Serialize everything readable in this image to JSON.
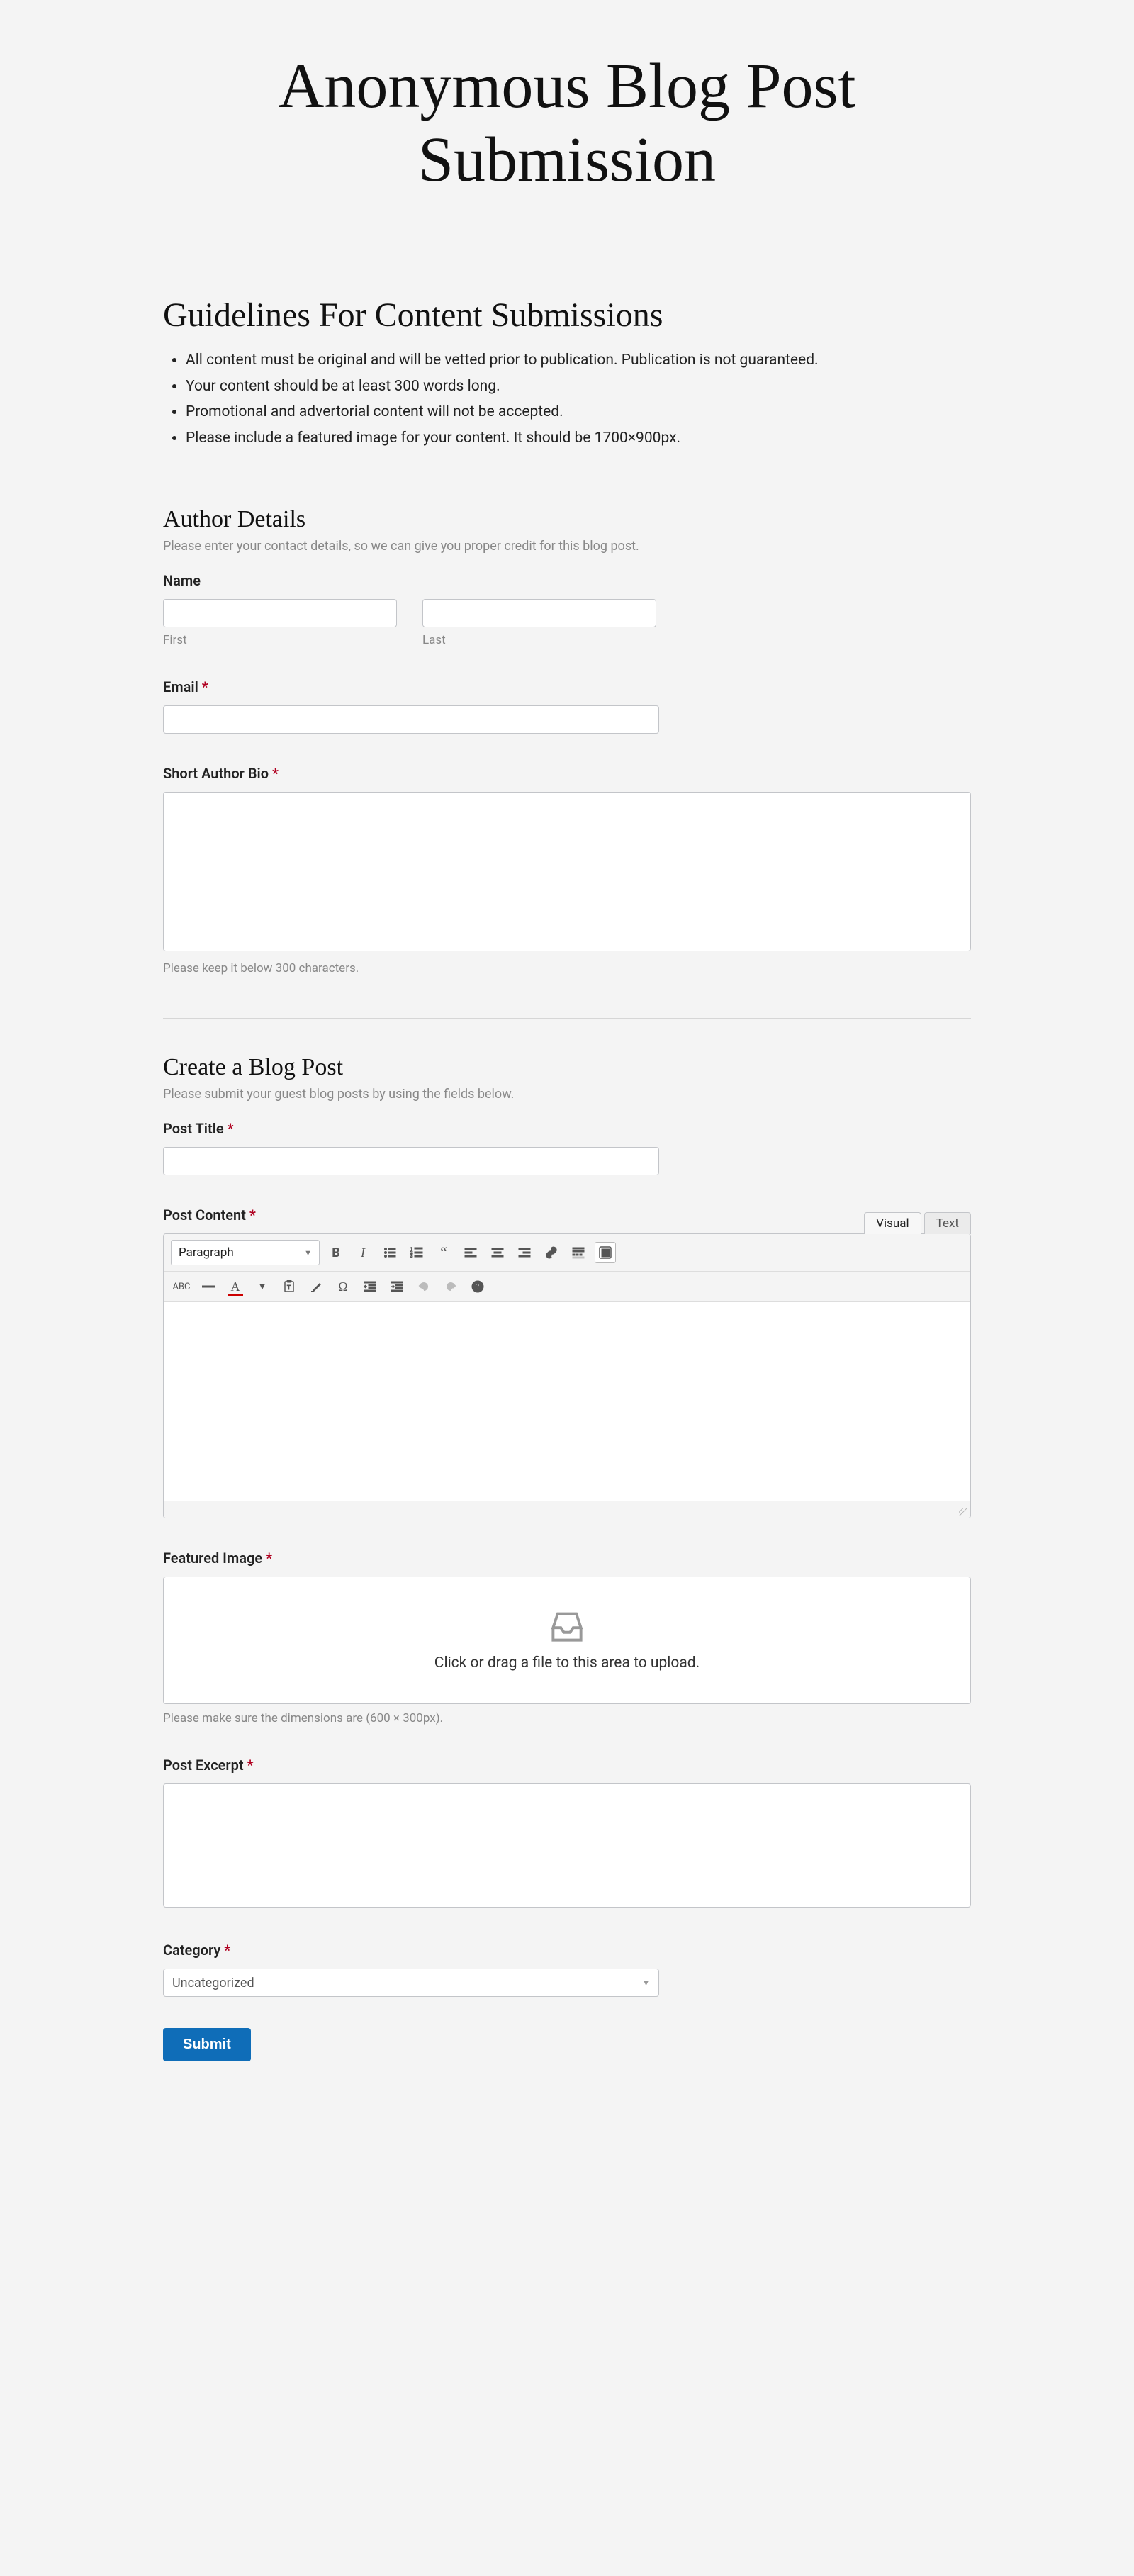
{
  "page_title": "Anonymous Blog Post Submission",
  "guidelines": {
    "heading": "Guidelines For Content Submissions",
    "items": [
      "All content must be original and will be vetted prior to publication. Publication is not guaranteed.",
      "Your content should be at least 300 words long.",
      "Promotional and advertorial content will not be accepted.",
      "Please include a featured image for your content. It should be 1700×900px."
    ]
  },
  "author": {
    "heading": "Author Details",
    "desc": "Please enter your contact details, so we can give you proper credit for this blog post.",
    "name_label": "Name",
    "first_sublabel": "First",
    "last_sublabel": "Last",
    "first_value": "",
    "last_value": "",
    "email_label": "Email",
    "email_value": "",
    "bio_label": "Short Author Bio",
    "bio_value": "",
    "bio_hint": "Please keep it below 300 characters."
  },
  "post": {
    "heading": "Create a Blog Post",
    "desc": "Please submit your guest blog posts by using the fields below.",
    "title_label": "Post Title",
    "title_value": "",
    "content_label": "Post Content",
    "tabs": {
      "visual": "Visual",
      "text": "Text"
    },
    "format_select": "Paragraph",
    "featured_label": "Featured Image",
    "uploader_text": "Click or drag a file to this area to upload.",
    "featured_hint": "Please make sure the dimensions are (600 × 300px).",
    "excerpt_label": "Post Excerpt",
    "excerpt_value": "",
    "category_label": "Category",
    "category_value": "Uncategorized"
  },
  "required_marker": "*",
  "submit_label": "Submit"
}
